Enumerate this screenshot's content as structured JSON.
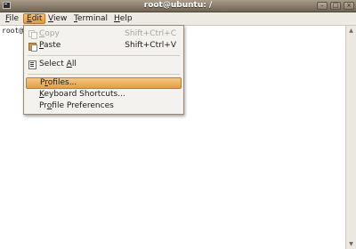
{
  "window": {
    "title": "root@ubuntu: /"
  },
  "titlebar_buttons": [
    {
      "name": "minimize",
      "glyph": "–"
    },
    {
      "name": "maximize",
      "glyph": "□"
    },
    {
      "name": "close",
      "glyph": "×"
    }
  ],
  "menubar": {
    "file": {
      "pre": "",
      "key": "F",
      "post": "ile"
    },
    "edit": {
      "pre": "",
      "key": "E",
      "post": "dit"
    },
    "view": {
      "pre": "",
      "key": "V",
      "post": "iew"
    },
    "terminal": {
      "pre": "",
      "key": "T",
      "post": "erminal"
    },
    "help": {
      "pre": "",
      "key": "H",
      "post": "elp"
    }
  },
  "terminal": {
    "prompt": "root@"
  },
  "edit_menu": {
    "copy": {
      "pre": "",
      "key": "C",
      "post": "opy",
      "shortcut": "Shift+Ctrl+C",
      "enabled": false
    },
    "paste": {
      "pre": "",
      "key": "P",
      "post": "aste",
      "shortcut": "Shift+Ctrl+V"
    },
    "select_all": {
      "pre": "Select ",
      "key": "A",
      "post": "ll"
    },
    "profiles": {
      "pre": "P",
      "key": "r",
      "post": "ofiles..."
    },
    "keyboard_shortcuts": {
      "pre": "",
      "key": "K",
      "post": "eyboard Shortcuts..."
    },
    "profile_preferences": {
      "pre": "Pr",
      "key": "o",
      "post": "file Preferences"
    }
  },
  "colors": {
    "menu_highlight": "#e39f44",
    "titlebar": "#6f6353",
    "menubar": "#ede9e3"
  }
}
